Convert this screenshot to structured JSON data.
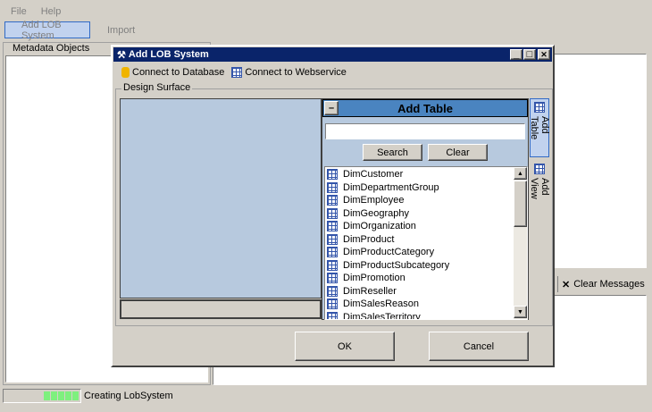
{
  "menu": [
    "File",
    "Help"
  ],
  "toolbar": {
    "add_lob": "Add LOB System",
    "import": "Import"
  },
  "metadata_panel": {
    "title": "Metadata Objects"
  },
  "messages": {
    "clear": "Clear Messages"
  },
  "status": {
    "text": "Creating LobSystem",
    "progress_blocks": 5
  },
  "dialog": {
    "title": "Add LOB System",
    "toolbar": {
      "db": "Connect to Database",
      "ws": "Connect to Webservice"
    },
    "group": "Design Surface",
    "add_table": {
      "title": "Add Table",
      "search_value": "",
      "search": "Search",
      "clear": "Clear",
      "items": [
        "DimCustomer",
        "DimDepartmentGroup",
        "DimEmployee",
        "DimGeography",
        "DimOrganization",
        "DimProduct",
        "DimProductCategory",
        "DimProductSubcategory",
        "DimPromotion",
        "DimReseller",
        "DimSalesReason",
        "DimSalesTerritory"
      ]
    },
    "side_tabs": [
      "Add Table",
      "Add View"
    ],
    "ok": "OK",
    "cancel": "Cancel"
  }
}
